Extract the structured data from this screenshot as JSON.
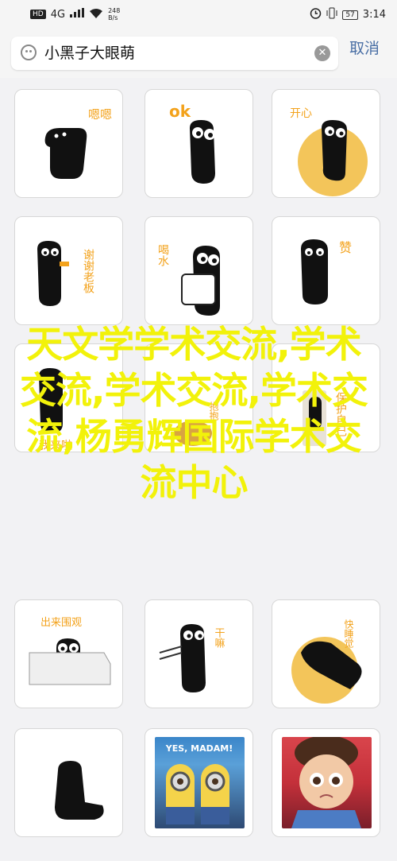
{
  "status_bar": {
    "hd_label": "HD",
    "network": "4G",
    "speed_value": "248",
    "speed_unit": "B/s",
    "battery": "57",
    "time": "3:14"
  },
  "search": {
    "query": "小黑子大眼萌",
    "cancel_label": "取消"
  },
  "stickers": [
    {
      "caption": "嗯嗯",
      "caption_color": "#f3a21b"
    },
    {
      "caption": "ok",
      "caption_color": "#f3a21b"
    },
    {
      "caption": "开心",
      "caption_color": "#f3a21b"
    },
    {
      "caption": "谢谢老板",
      "caption_color": "#f3a21b"
    },
    {
      "caption": "喝水",
      "caption_color": "#f3a21b"
    },
    {
      "caption": "赞",
      "caption_color": "#f3a21b"
    },
    {
      "caption": "我来啦",
      "caption_color": "#f3a21b"
    },
    {
      "caption": "抱抱",
      "caption_color": "#f3a21b"
    },
    {
      "caption": "保护自己",
      "caption_color": "#f3a21b"
    },
    {
      "caption": "出来围观",
      "caption_color": "#f3a21b"
    },
    {
      "caption": "干嘛",
      "caption_color": "#f3a21b"
    },
    {
      "caption": "快睡觉",
      "caption_color": "#f3a21b"
    },
    {
      "caption": "",
      "caption_color": "#f3a21b"
    },
    {
      "caption": "YES, MADAM!",
      "caption_color": "#ffffff"
    },
    {
      "caption": "",
      "caption_color": "#f3a21b"
    }
  ],
  "overlay_text": "天文学学术交流,学术交流,学术交流,学术交流,杨勇辉国际学术交流中心",
  "colors": {
    "accent_yellow": "#f3a21b",
    "overlay": "#f2f20a",
    "cancel": "#4a6fa5"
  }
}
